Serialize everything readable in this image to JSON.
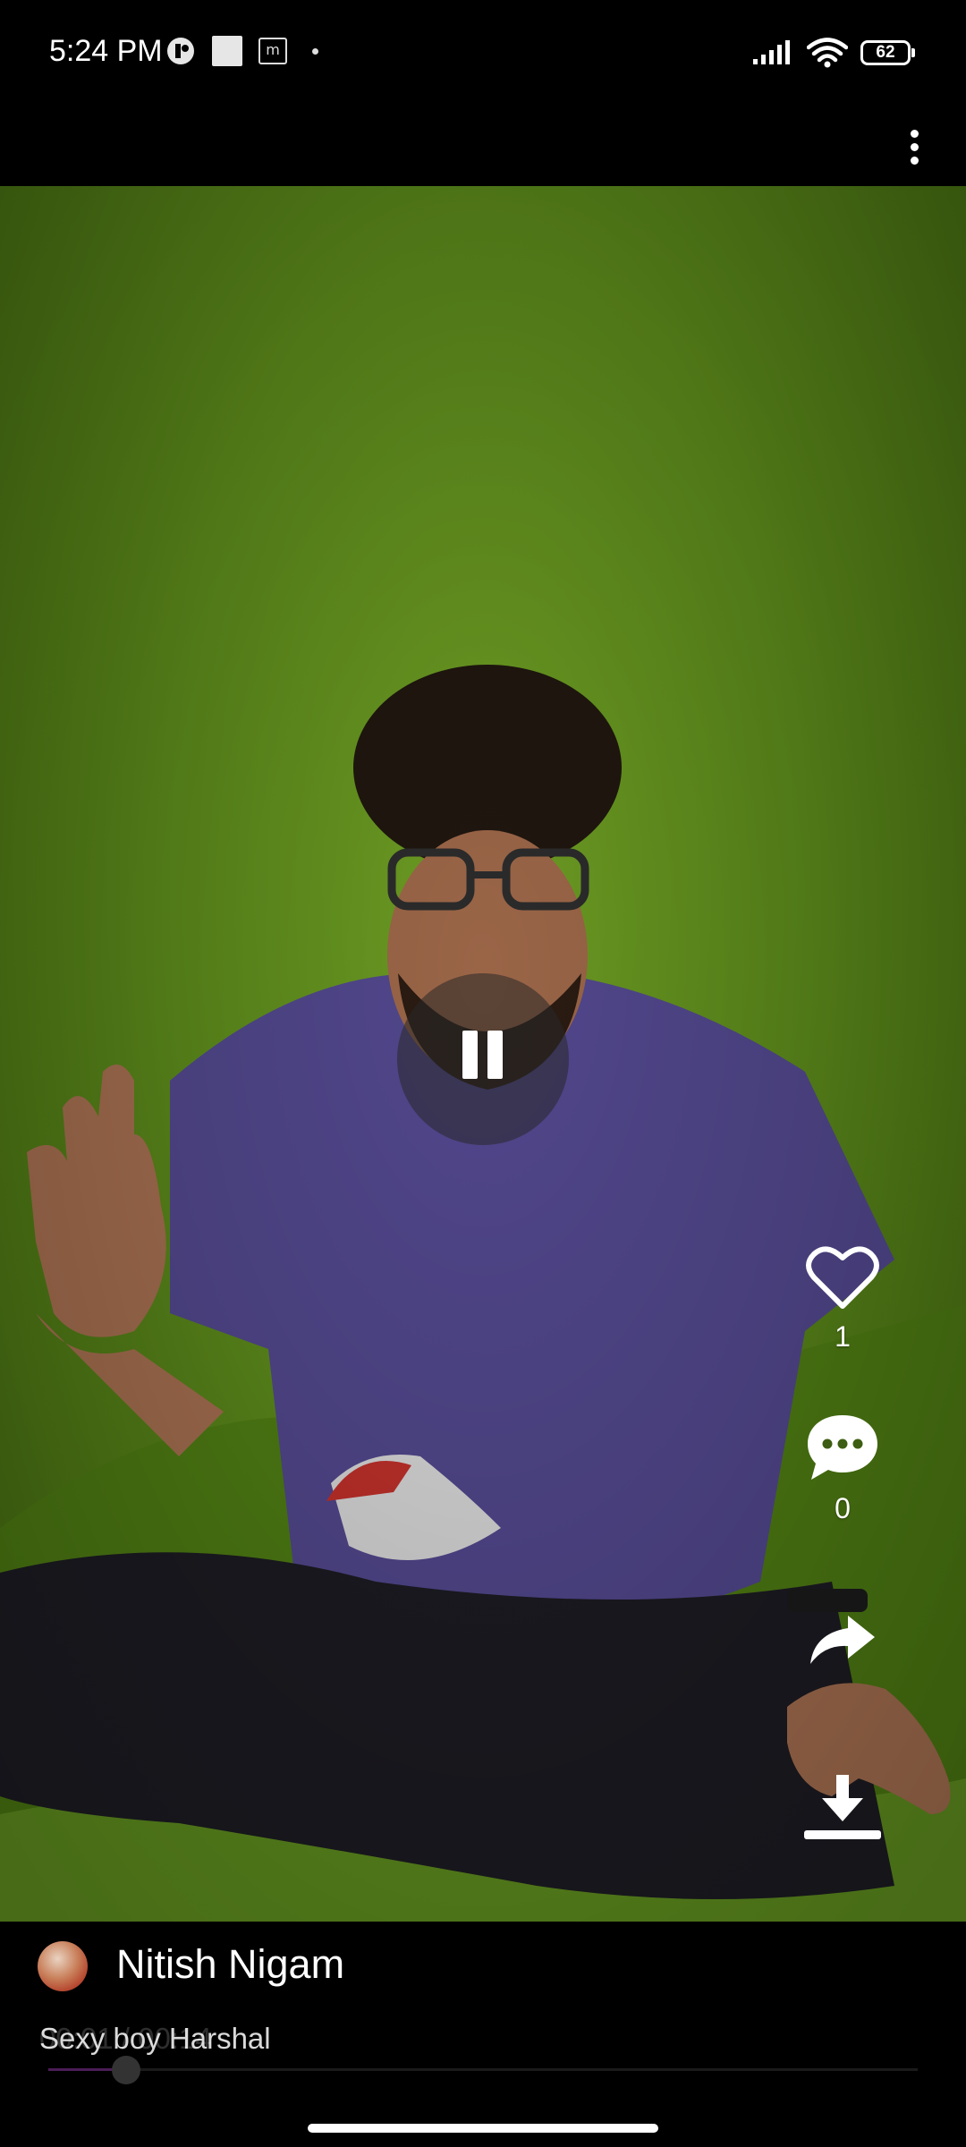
{
  "status_bar": {
    "time": "5:24 PM",
    "battery": "62",
    "icons": [
      "app-notification-icon",
      "square-notification-icon",
      "m-notification-icon",
      "dot-icon",
      "signal-icon",
      "wifi-icon",
      "battery-icon"
    ]
  },
  "toolbar": {
    "more_icon": "more-vert-icon"
  },
  "video": {
    "state_icon": "pause-icon"
  },
  "actions": {
    "like_icon": "heart-outline-icon",
    "like_count": "1",
    "comment_icon": "comment-bubble-icon",
    "comment_count": "0",
    "share_icon": "share-arrow-icon",
    "download_icon": "download-icon"
  },
  "info": {
    "channel_name": "Nitish Nigam",
    "caption": "Sexy boy Harshal",
    "time_readout": "00:01 / 00:14",
    "progress_fraction": 0.09
  },
  "colors": {
    "background": "#000000",
    "video_backdrop": "#5c8a1b",
    "seek_fill": "#4a1d56"
  }
}
